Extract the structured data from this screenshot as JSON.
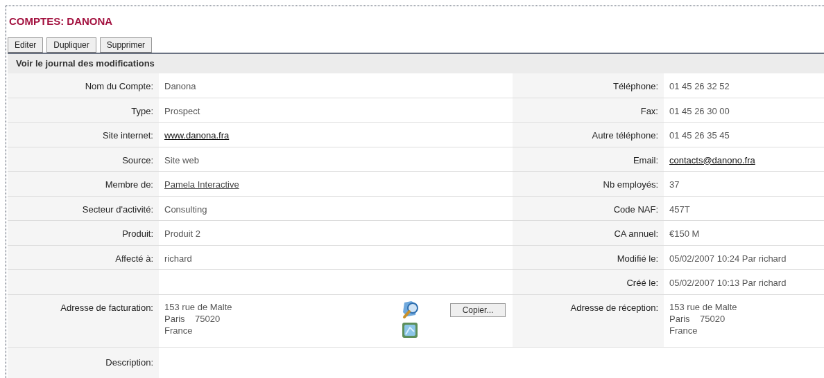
{
  "title": "COMPTES: DANONA",
  "buttons": [
    "Editer",
    "Dupliquer",
    "Supprimer"
  ],
  "section": "Voir le journal des modifications",
  "rows": [
    {
      "left": {
        "label": "Nom du Compte:",
        "value": "Danona",
        "kind": "text"
      },
      "right": {
        "label": "Téléphone:",
        "value": "01 45 26 32 52",
        "kind": "text"
      }
    },
    {
      "left": {
        "label": "Type:",
        "value": "Prospect",
        "kind": "text"
      },
      "right": {
        "label": "Fax:",
        "value": "01 45 26 30 00",
        "kind": "text"
      }
    },
    {
      "left": {
        "label": "Site internet:",
        "value": "www.danona.fra",
        "kind": "link"
      },
      "right": {
        "label": "Autre téléphone:",
        "value": "01 45 26 35 45",
        "kind": "text"
      }
    },
    {
      "left": {
        "label": "Source:",
        "value": "Site web",
        "kind": "text"
      },
      "right": {
        "label": "Email:",
        "value": "contacts@danono.fra",
        "kind": "link"
      }
    },
    {
      "left": {
        "label": "Membre de:",
        "value": "Pamela Interactive",
        "kind": "record"
      },
      "right": {
        "label": "Nb employés:",
        "value": "37",
        "kind": "text"
      }
    },
    {
      "left": {
        "label": "Secteur d'activité:",
        "value": "Consulting",
        "kind": "text"
      },
      "right": {
        "label": "Code NAF:",
        "value": "457T",
        "kind": "text"
      }
    },
    {
      "left": {
        "label": "Produit:",
        "value": "Produit 2",
        "kind": "text"
      },
      "right": {
        "label": "CA annuel:",
        "value": "€150 M",
        "kind": "text"
      }
    },
    {
      "left": {
        "label": "Affecté à:",
        "value": "richard",
        "kind": "text"
      },
      "right": {
        "label": "Modifié le:",
        "value": "05/02/2007 10:24 Par richard",
        "kind": "text"
      }
    },
    {
      "right": {
        "label": "Créé le:",
        "value": "05/02/2007 10:13 Par richard",
        "kind": "text"
      }
    }
  ],
  "billing": {
    "label": "Adresse de facturation:",
    "lines": [
      "153 rue de Malte",
      "Paris    75020",
      "France"
    ],
    "copy_button": "Copier..."
  },
  "shipping": {
    "label": "Adresse de réception:",
    "lines": [
      "153 rue de Malte",
      "Paris    75020",
      "France"
    ]
  },
  "description": {
    "label": "Description:"
  }
}
